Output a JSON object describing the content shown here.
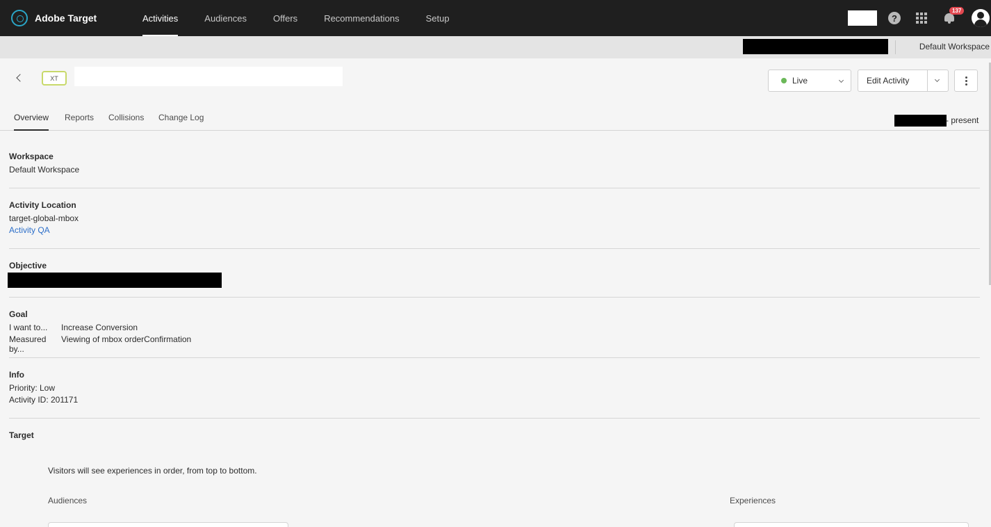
{
  "app": {
    "name": "Adobe Target"
  },
  "nav": {
    "items": [
      {
        "label": "Activities",
        "active": true
      },
      {
        "label": "Audiences",
        "active": false
      },
      {
        "label": "Offers",
        "active": false
      },
      {
        "label": "Recommendations",
        "active": false
      },
      {
        "label": "Setup",
        "active": false
      }
    ],
    "help_glyph": "?",
    "notifications_count": "137"
  },
  "workspace_bar": {
    "workspace_label": "Default Workspace"
  },
  "activity": {
    "type_badge": "XT",
    "status_label": "Live",
    "status_color": "#6bb859",
    "edit_label": "Edit Activity"
  },
  "tabs": [
    {
      "label": "Overview",
      "active": true
    },
    {
      "label": "Reports",
      "active": false
    },
    {
      "label": "Collisions",
      "active": false
    },
    {
      "label": "Change Log",
      "active": false
    }
  ],
  "date_range": {
    "end": "- present"
  },
  "overview": {
    "workspace": {
      "title": "Workspace",
      "value": "Default Workspace"
    },
    "location": {
      "title": "Activity Location",
      "value": "target-global-mbox",
      "link": "Activity QA"
    },
    "objective": {
      "title": "Objective"
    },
    "goal": {
      "title": "Goal",
      "want_label": "I want to...",
      "want_value": "Increase Conversion",
      "measured_label": "Measured by...",
      "measured_value": "Viewing of mbox orderConfirmation"
    },
    "info": {
      "title": "Info",
      "priority": "Priority: Low",
      "activity_id": "Activity ID: 201171"
    },
    "target": {
      "title": "Target",
      "note": "Visitors will see experiences in order, from top to bottom.",
      "audiences_label": "Audiences",
      "experiences_label": "Experiences"
    }
  },
  "icons": {
    "logo": "adobe-target-logo",
    "help": "help-icon",
    "apps": "apps-grid-icon",
    "bell": "bell-icon",
    "avatar": "avatar-icon",
    "back": "chevron-left-icon",
    "more": "more-vertical-icon"
  }
}
